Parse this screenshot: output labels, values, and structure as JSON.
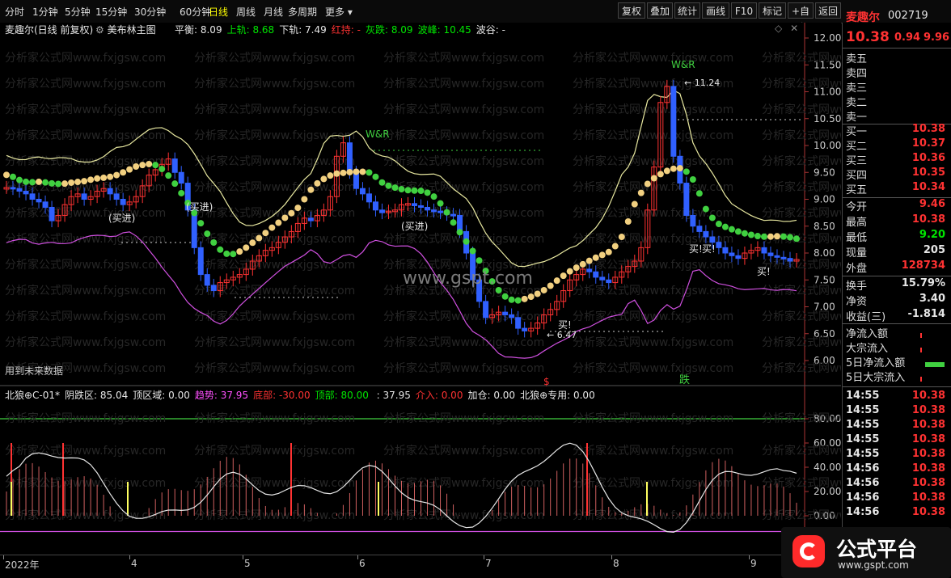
{
  "toolbar": {
    "timeframes": [
      "分时",
      "1分钟",
      "5分钟",
      "15分钟",
      "30分钟",
      "60分钟",
      "日线",
      "周线",
      "月线",
      "多周期",
      "更多"
    ],
    "active": "日线",
    "right_buttons": [
      "复权",
      "叠加",
      "统计",
      "画线",
      "F10",
      "标记",
      "+自选",
      "返回"
    ]
  },
  "main": {
    "title": "麦趣尔(日线 前复权)",
    "indicator": "美布林主图",
    "legend": [
      {
        "label": "平衡:",
        "value": "8.09",
        "color": "#e6e6e6"
      },
      {
        "label": "上轨:",
        "value": "8.68",
        "color": "#00e600"
      },
      {
        "label": "下轨:",
        "value": "7.49",
        "color": "#e6e6e6"
      },
      {
        "label": "红持:",
        "value": "-",
        "color": "#ff3232"
      },
      {
        "label": "灰跌:",
        "value": "8.09",
        "color": "#00e600"
      },
      {
        "label": "波峰:",
        "value": "10.45",
        "color": "#00e600"
      },
      {
        "label": "波谷:",
        "value": "-",
        "color": "#e6e6e6"
      }
    ],
    "y_ticks": [
      "12.00",
      "11.50",
      "11.00",
      "10.50",
      "10.00",
      "9.50",
      "9.00",
      "8.50",
      "8.00",
      "7.50",
      "7.00",
      "6.50",
      "6.00"
    ],
    "annotations": {
      "buy_labels": [
        "(买进)",
        "(买进)",
        "(买进)"
      ],
      "wr": [
        "W&R",
        "W&R"
      ],
      "high_mark": "11.24",
      "low_mark": "6.47",
      "buy_marks": [
        "买!",
        "买!",
        "买!",
        "买!"
      ],
      "dollar": "$",
      "fall": "跌",
      "future_note": "用到未来数据"
    },
    "watermark": "www.gspt.com",
    "repeat_watermark": "分析家公式网www.fxjgsw.com"
  },
  "sub": {
    "name": "北狼⊕C-01*",
    "legend": [
      {
        "label": "阴跌区:",
        "value": "85.04",
        "color": "#e6e6e6"
      },
      {
        "label": "顶区域:",
        "value": "0.00",
        "color": "#e6e6e6"
      },
      {
        "label": "趋势:",
        "value": "37.95",
        "color": "#ff50ff"
      },
      {
        "label": "底部:",
        "value": "-30.00",
        "color": "#ff3232"
      },
      {
        "label": "顶部:",
        "value": "80.00",
        "color": "#00e600"
      },
      {
        "label": "",
        "value": ": 37.95",
        "color": "#e6e6e6"
      },
      {
        "label": "介入:",
        "value": "0.00",
        "color": "#ff3232"
      },
      {
        "label": "加仓:",
        "value": "0.00",
        "color": "#e6e6e6"
      },
      {
        "label": "北狼⊕专用:",
        "value": "0.00",
        "color": "#e6e6e6"
      }
    ],
    "y_ticks": [
      "80.00",
      "60.00",
      "40.00",
      "20.00",
      "0.00"
    ]
  },
  "date_axis": [
    "2022年",
    "4",
    "5",
    "6",
    "7",
    "8",
    "9"
  ],
  "stock": {
    "name": "麦趣尔",
    "code": "002719",
    "price": "10.38",
    "change": "0.94",
    "change_pct": "9.96"
  },
  "sell_levels": [
    "卖五",
    "卖四",
    "卖三",
    "卖二",
    "卖一"
  ],
  "buy_levels": [
    {
      "label": "买一",
      "price": "10.38"
    },
    {
      "label": "买二",
      "price": "10.37"
    },
    {
      "label": "买三",
      "price": "10.36"
    },
    {
      "label": "买四",
      "price": "10.35"
    },
    {
      "label": "买五",
      "price": "10.34"
    }
  ],
  "stats": [
    {
      "label": "今开",
      "value": "9.46",
      "color": "#ff3232"
    },
    {
      "label": "最高",
      "value": "10.38",
      "color": "#ff3232"
    },
    {
      "label": "最低",
      "value": "9.20",
      "color": "#00e600"
    },
    {
      "label": "现量",
      "value": "205",
      "color": "#e6e6e6"
    },
    {
      "label": "外盘",
      "value": "128734",
      "color": "#ff3232"
    }
  ],
  "stats2": [
    {
      "label": "换手",
      "value": "15.79%",
      "color": "#e6e6e6"
    },
    {
      "label": "净资",
      "value": "3.40",
      "color": "#e6e6e6"
    },
    {
      "label": "收益(三)",
      "value": "-1.814",
      "color": "#e6e6e6"
    }
  ],
  "flow": [
    "净流入额",
    "大宗流入",
    "5日净流入额",
    "5日大宗流入"
  ],
  "ticks": [
    {
      "time": "14:55",
      "price": "10.38"
    },
    {
      "time": "14:55",
      "price": "10.38"
    },
    {
      "time": "14:55",
      "price": "10.38"
    },
    {
      "time": "14:55",
      "price": "10.38"
    },
    {
      "time": "14:55",
      "price": "10.38"
    },
    {
      "time": "14:56",
      "price": "10.38"
    },
    {
      "time": "14:56",
      "price": "10.38"
    },
    {
      "time": "14:56",
      "price": "10.38"
    },
    {
      "time": "14:56",
      "price": "10.38"
    }
  ],
  "logo": {
    "text": "公式平台",
    "url": "www.gspt.com"
  }
}
